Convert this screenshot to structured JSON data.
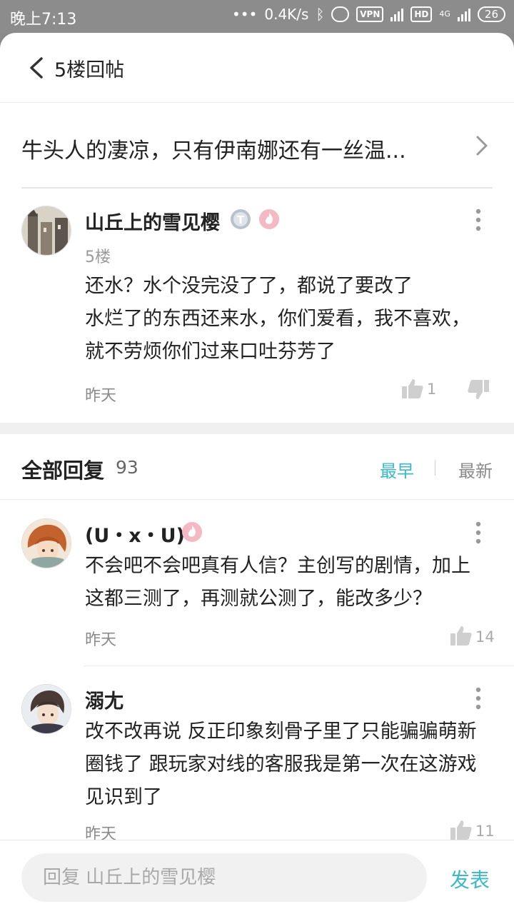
{
  "status_bar": {
    "time": "晚上7:13",
    "network_speed": "0.4K/s",
    "vpn": "VPN",
    "hd": "HD",
    "network_type": "4G",
    "battery": "26"
  },
  "nav": {
    "title": "5楼回帖"
  },
  "thread": {
    "title": "牛头人的凄凉，只有伊南娜还有一丝温..."
  },
  "main_post": {
    "username": "山丘上的雪见樱",
    "floor": "5楼",
    "lines": [
      "还水？水个没完没了了，都说了要改了",
      "水烂了的东西还来水，你们爱看，我不喜欢，",
      "就不劳烦你们过来口吐芬芳了"
    ],
    "time": "昨天",
    "likes": "1"
  },
  "replies_header": {
    "title": "全部回复",
    "count": "93",
    "sort_earliest": "最早",
    "sort_latest": "最新"
  },
  "replies": [
    {
      "username": "(U・x・U)",
      "lines": [
        "不会吧不会吧真有人信？主创写的剧情，加上",
        "这都三测了，再测就公测了，能改多少？"
      ],
      "time": "昨天",
      "likes": "14"
    },
    {
      "username": "溺尢",
      "lines": [
        "改不改再说 反正印象刻骨子里了只能骗骗萌新",
        "圈钱了 跟玩家对线的客服我是第一次在这游戏",
        "见识到了"
      ],
      "time": "昨天",
      "likes": "11"
    }
  ],
  "reply_bar": {
    "placeholder": "回复 山丘上的雪见樱",
    "send_label": "发表"
  },
  "colors": {
    "accent": "#3db8c8",
    "status_bar": "#8c8c8c"
  }
}
